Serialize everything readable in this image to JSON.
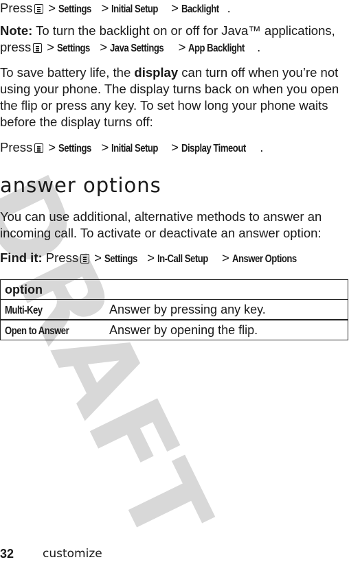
{
  "watermark": "DRAFT",
  "para1": {
    "press": "Press",
    "icon": "menu-key-icon",
    "path": [
      "Settings",
      "Initial Setup",
      "Backlight"
    ],
    "end": "."
  },
  "note": {
    "label": "Note:",
    "text": "To turn the backlight on or off for Java™ applications,",
    "press": "press",
    "path": [
      "Settings",
      "Java Settings",
      "App Backlight"
    ],
    "end": "."
  },
  "para2": {
    "lines": [
      [
        "To save battery life, the ",
        "display",
        " can turn off when you’re not"
      ],
      "using your phone. The display turns back on when you open",
      "the flip or press any key. To set how long your phone waits",
      "before the display turns off:"
    ]
  },
  "para3": {
    "press": "Press",
    "path": [
      "Settings",
      "Initial Setup",
      "Display Timeout"
    ],
    "end": "."
  },
  "heading": "answer options",
  "para4": {
    "lines": [
      "You can use additional, alternative methods to answer an",
      "incoming call. To activate or deactivate an answer option:"
    ]
  },
  "findit": {
    "label": "Find it:",
    "press": "Press",
    "path": [
      "Settings",
      "In-Call Setup",
      "Answer Options"
    ]
  },
  "table": {
    "header": "option",
    "rows": [
      {
        "name": "Multi-Key",
        "desc": "Answer by pressing any key."
      },
      {
        "name": "Open to Answer",
        "desc": "Answer by opening the flip."
      }
    ]
  },
  "footer": {
    "page": "32",
    "section": "customize"
  },
  "sep": ">"
}
